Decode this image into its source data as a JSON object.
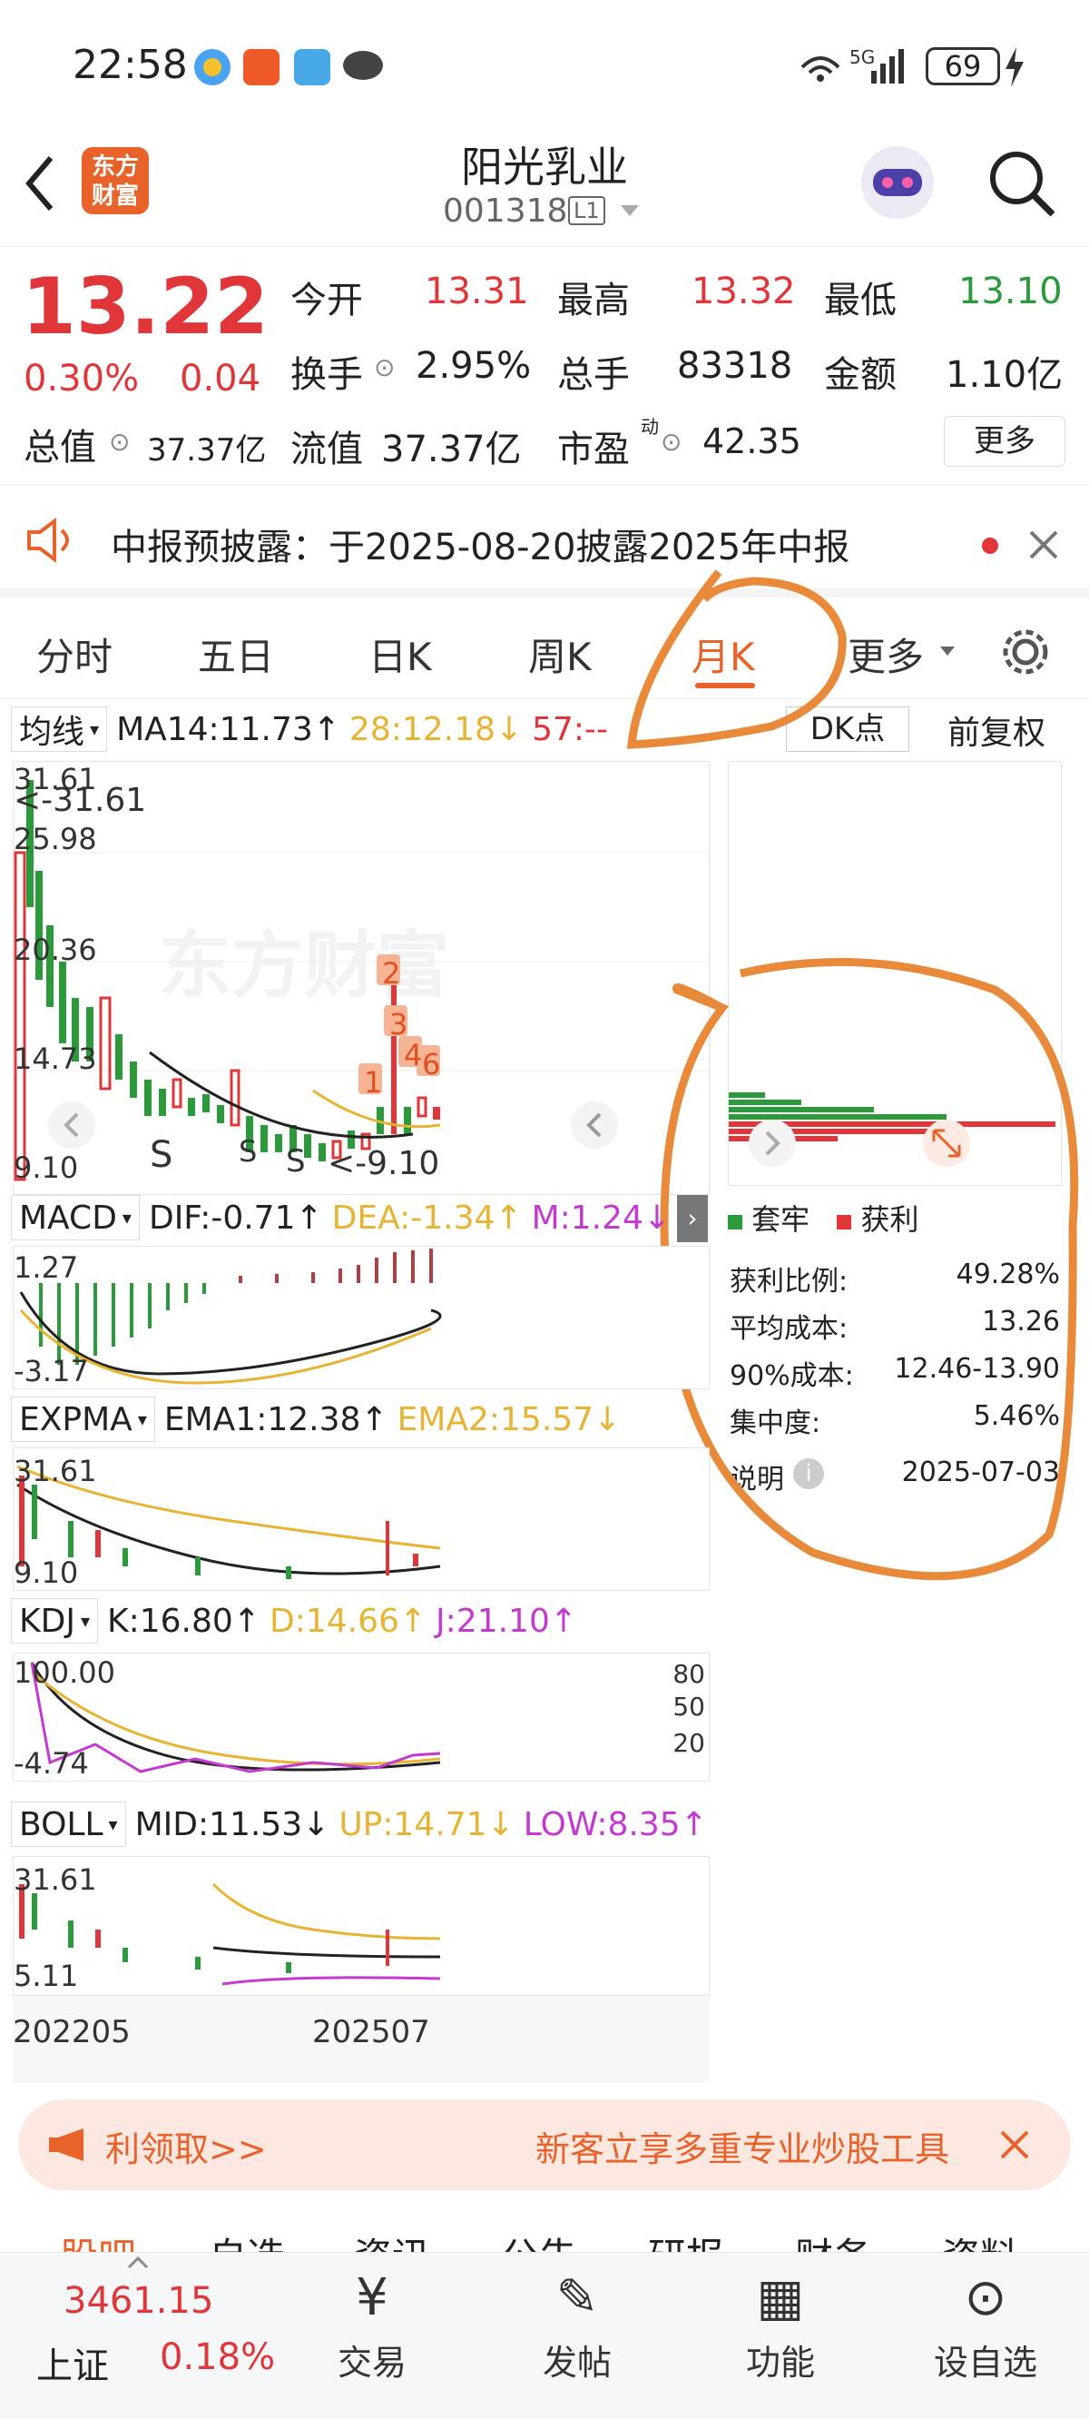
{
  "status_bar": {
    "time": "22:58",
    "network": "5G",
    "battery": "69"
  },
  "header": {
    "broker_logo": "东方财富",
    "stock_name": "阳光乳业",
    "stock_code": "001318",
    "level": "L1"
  },
  "quote": {
    "price": "13.22",
    "change_pct": "0.30%",
    "change": "0.04",
    "open_label": "今开",
    "open": "13.31",
    "high_label": "最高",
    "high": "13.32",
    "low_label": "最低",
    "low": "13.10",
    "turnover_label": "换手",
    "turnover": "2.95%",
    "volume_label": "总手",
    "volume": "83318",
    "amount_label": "金额",
    "amount": "1.10亿",
    "mktcap_label": "总值",
    "mktcap": "37.37亿",
    "float_label": "流值",
    "float_cap": "37.37亿",
    "pe_label": "市盈",
    "pe_sup": "动",
    "pe": "42.35",
    "more_label": "更多"
  },
  "notice": {
    "text": "中报预披露：于2025-08-20披露2025年中报"
  },
  "tabs": [
    {
      "label": "分时"
    },
    {
      "label": "五日"
    },
    {
      "label": "日K"
    },
    {
      "label": "周K"
    },
    {
      "label": "月K"
    },
    {
      "label": "更多"
    }
  ],
  "main_chart": {
    "indicator": "均线",
    "ma14": "MA14:11.73↑",
    "ma28": "28:12.18↓",
    "ma57": "57:--",
    "dk_label": "DK点",
    "adjust": "前复权",
    "y_top": "31.61",
    "y2": "25.98",
    "y3": "20.36",
    "y4": "14.73",
    "y_bottom": "9.10",
    "max_label": "<-31.61",
    "min_label": "<-9.10",
    "marker_s1": "S",
    "marker_s2": "S",
    "marker_s3": "S",
    "nums": [
      "2",
      "3",
      "4",
      "6",
      "1"
    ],
    "watermark": "东方财富"
  },
  "macd": {
    "name": "MACD",
    "dif": "DIF:-0.71↑",
    "dea": "DEA:-1.34↑",
    "m": "M:1.24↓",
    "y_top": "1.27",
    "y_bottom": "-3.17"
  },
  "expma": {
    "name": "EXPMA",
    "ema1": "EMA1:12.38↑",
    "ema2": "EMA2:15.57↓",
    "y_top": "31.61",
    "y_bottom": "9.10"
  },
  "kdj": {
    "name": "KDJ",
    "k": "K:16.80↑",
    "d": "D:14.66↑",
    "j": "J:21.10↑",
    "y_top": "100.00",
    "y_bottom": "-4.74",
    "r80": "80",
    "r50": "50",
    "r20": "20"
  },
  "boll": {
    "name": "BOLL",
    "mid": "MID:11.53↓",
    "up": "UP:14.71↓",
    "low": "LOW:8.35↑",
    "y_top": "31.61",
    "y_bottom": "5.11"
  },
  "xaxis": {
    "start": "202205",
    "end": "202507"
  },
  "chip": {
    "legend_trapped": "套牢",
    "legend_profit": "获利",
    "rows": [
      {
        "label": "获利比例:",
        "value": "49.28%"
      },
      {
        "label": "平均成本:",
        "value": "13.26"
      },
      {
        "label": "90%成本:",
        "value": "12.46-13.90"
      },
      {
        "label": "集中度:",
        "value": "5.46%"
      }
    ],
    "note_label": "说明",
    "date": "2025-07-03"
  },
  "promo": {
    "left": "利领取>>",
    "right": "新客立享多重专业炒股工具"
  },
  "bottom_tabs_partial": [
    "股吧",
    "自选",
    "资讯",
    "公告",
    "研报",
    "财务",
    "资料"
  ],
  "bottom_nav": {
    "index_value": "3461.15",
    "index_name": "上证",
    "index_change": "0.18%",
    "items": [
      {
        "label": "交易"
      },
      {
        "label": "发帖"
      },
      {
        "label": "功能"
      },
      {
        "label": "设自选"
      }
    ]
  },
  "colors": {
    "up": "#e0363a",
    "down": "#2a9a3a",
    "accent": "#e8622a",
    "gold": "#e6b432",
    "purple": "#c43ad0"
  }
}
